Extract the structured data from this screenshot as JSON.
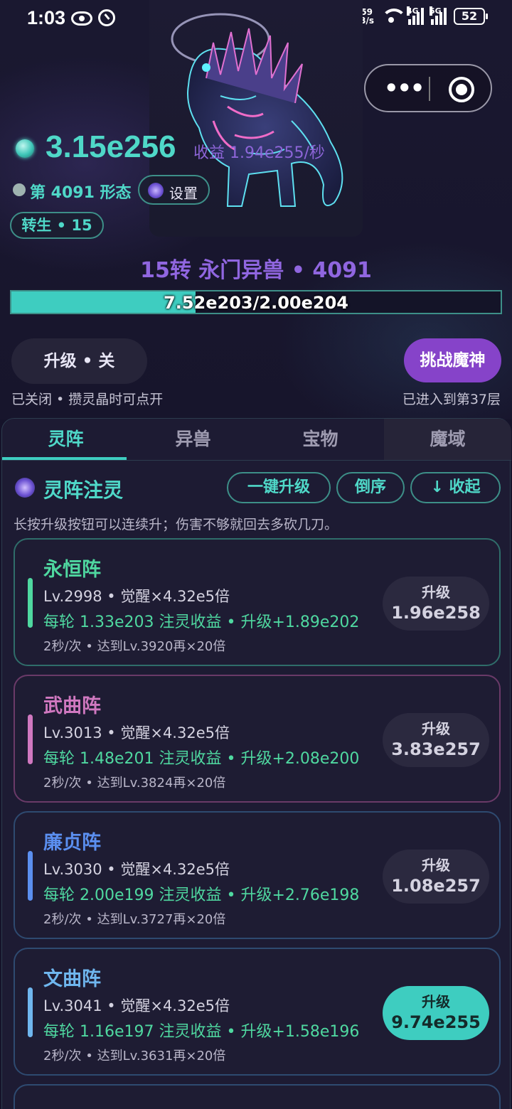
{
  "status_bar": {
    "time": "1:03",
    "net_speed_value": "59",
    "net_speed_unit": "B/s",
    "sig1_tag": "4G",
    "sig2_tag": "5G",
    "battery": "52"
  },
  "header": {
    "crystals": "3.15e256",
    "income": "收益 1.94e255/秒",
    "form": "第 4091 形态",
    "settings_label": "设置",
    "rebirth": "转生 • 15",
    "stage_title": "15转 永门异兽 • 4091",
    "progress_text": "7.52e203/2.00e204",
    "progress_fraction": 0.376,
    "upgrade_toggle": "升级 • 关",
    "challenge": "挑战魔神",
    "closed_note": "已关闭 • 攒灵晶时可点开",
    "layer_note": "已进入到第37层"
  },
  "tabs": [
    {
      "label": "灵阵"
    },
    {
      "label": "异兽"
    },
    {
      "label": "宝物"
    },
    {
      "label": "魔域"
    }
  ],
  "section": {
    "title": "灵阵注灵",
    "btn_all": "一键升级",
    "btn_reverse": "倒序",
    "btn_collapse": "↓ 收起",
    "hint": "长按升级按钮可以连续升；伤害不够就回去多砍几刀。"
  },
  "arrays": [
    {
      "name": "永恒阵",
      "accent": "#4fd8a0",
      "level": "Lv.2998 • 觉醒×4.32e5倍",
      "income": "每轮 1.33e203 注灵收益 • 升级+1.89e202",
      "rate": "2秒/次 • 达到Lv.3920再×20倍",
      "up_label": "升级",
      "cost": "1.96e258"
    },
    {
      "name": "武曲阵",
      "accent": "#d078c0",
      "level": "Lv.3013 • 觉醒×4.32e5倍",
      "income": "每轮 1.48e201 注灵收益 • 升级+2.08e200",
      "rate": "2秒/次 • 达到Lv.3824再×20倍",
      "up_label": "升级",
      "cost": "3.83e257"
    },
    {
      "name": "廉贞阵",
      "accent": "#5b8ff0",
      "level": "Lv.3030 • 觉醒×4.32e5倍",
      "income": "每轮 2.00e199 注灵收益 • 升级+2.76e198",
      "rate": "2秒/次 • 达到Lv.3727再×20倍",
      "up_label": "升级",
      "cost": "1.08e257"
    },
    {
      "name": "文曲阵",
      "accent": "#6fb6ee",
      "level": "Lv.3041 • 觉醒×4.32e5倍",
      "income": "每轮 1.16e197 注灵收益 • 升级+1.58e196",
      "rate": "2秒/次 • 达到Lv.3631再×20倍",
      "up_label": "升级",
      "cost": "9.74e255"
    }
  ]
}
